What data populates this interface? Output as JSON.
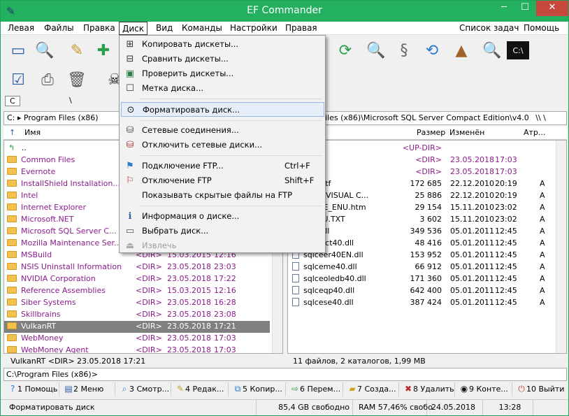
{
  "window": {
    "title": "EF Commander"
  },
  "menu": {
    "items": [
      "Левая",
      "Файлы",
      "Правка",
      "Диск",
      "Вид",
      "Команды",
      "Настройки",
      "Правая"
    ],
    "right": [
      "Список задач",
      "Помощь"
    ]
  },
  "drives": {
    "left": "C",
    "right": "\\"
  },
  "left": {
    "path": "C: ▸ Program Files (x86)",
    "col_name": "Имя",
    "updir": "..",
    "rows": [
      {
        "name": "Common Files",
        "d": "",
        "date": "",
        "time": ""
      },
      {
        "name": "Evernote",
        "d": "",
        "date": "",
        "time": ""
      },
      {
        "name": "InstallShield Installation...",
        "d": "",
        "date": "",
        "time": ""
      },
      {
        "name": "Intel",
        "d": "",
        "date": "",
        "time": ""
      },
      {
        "name": "Internet Explorer",
        "d": "",
        "date": "",
        "time": ""
      },
      {
        "name": "Microsoft.NET",
        "d": "",
        "date": "",
        "time": ""
      },
      {
        "name": "Microsoft SQL Server C...",
        "d": "",
        "date": "",
        "time": ""
      },
      {
        "name": "Mozilla Maintenance Ser...",
        "d": "",
        "date": "",
        "time": ""
      },
      {
        "name": "MSBuild",
        "d": "<DIR>",
        "date": "15.03.2015",
        "time": "12:16"
      },
      {
        "name": "NSIS Uninstall Information",
        "d": "<DIR>",
        "date": "23.05.2018",
        "time": "23:03"
      },
      {
        "name": "NVIDIA Corporation",
        "d": "<DIR>",
        "date": "23.05.2018",
        "time": "17:22"
      },
      {
        "name": "Reference Assemblies",
        "d": "<DIR>",
        "date": "15.03.2015",
        "time": "12:16"
      },
      {
        "name": "Siber Systems",
        "d": "<DIR>",
        "date": "23.05.2018",
        "time": "16:28"
      },
      {
        "name": "Skillbrains",
        "d": "<DIR>",
        "date": "23.05.2018",
        "time": "23:08"
      },
      {
        "name": "VulkanRT",
        "d": "<DIR>",
        "date": "23.05.2018",
        "time": "17:21"
      },
      {
        "name": "WebMoney",
        "d": "<DIR>",
        "date": "23.05.2018",
        "time": "17:03"
      },
      {
        "name": "WebMoney Agent",
        "d": "<DIR>",
        "date": "23.05.2018",
        "time": "17:03"
      }
    ],
    "status": "VulkanRT    <DIR>  23.05.2018   17:21"
  },
  "right": {
    "path": "rogram Files (x86)\\Microsoft SQL Server Compact Edition\\v4.0",
    "path_tail": "\\\\  \\",
    "col_size": "Размер",
    "col_date": "Изменён",
    "col_attr": "Атр...",
    "rows": [
      {
        "name": "",
        "size": "<UP-DIR>",
        "date": "",
        "time": "",
        "attr": ""
      },
      {
        "name": "p",
        "size": "<DIR>",
        "date": "23.05.2018",
        "time": "17:03",
        "attr": ""
      },
      {
        "name": "",
        "size": "<DIR>",
        "date": "23.05.2018",
        "time": "17:03",
        "attr": ""
      },
      {
        "name": "ENU.rtf",
        "size": "172 685",
        "date": "22.12.2010",
        "time": "20:19",
        "attr": "A"
      },
      {
        "name": "SOFT VISUAL C...",
        "size": "25 886",
        "date": "22.12.2010",
        "time": "20:19",
        "attr": "A"
      },
      {
        "name": "eSSCE_ENU.htm",
        "size": "29 154",
        "date": "15.11.2010",
        "time": "23:02",
        "attr": "A"
      },
      {
        "name": "T_ENU.TXT",
        "size": "3 602",
        "date": "15.11.2010",
        "time": "23:02",
        "attr": "A"
      },
      {
        "name": "e40.dll",
        "size": "349 536",
        "date": "05.01.2011",
        "time": "12:45",
        "attr": "A"
      },
      {
        "name": "ompact40.dll",
        "size": "48 416",
        "date": "05.01.2011",
        "time": "12:45",
        "attr": "A"
      },
      {
        "name": "sqlceer40EN.dll",
        "size": "153 952",
        "date": "05.01.2011",
        "time": "12:45",
        "attr": "A"
      },
      {
        "name": "sqlceme40.dll",
        "size": "66 912",
        "date": "05.01.2011",
        "time": "12:45",
        "attr": "A"
      },
      {
        "name": "sqlceoledb40.dll",
        "size": "171 360",
        "date": "05.01.2011",
        "time": "12:45",
        "attr": "A"
      },
      {
        "name": "sqlceqp40.dll",
        "size": "642 400",
        "date": "05.01.2011",
        "time": "12:45",
        "attr": "A"
      },
      {
        "name": "sqlcese40.dll",
        "size": "387 424",
        "date": "05.01.2011",
        "time": "12:45",
        "attr": "A"
      }
    ],
    "status": "11 файлов, 2 каталогов, 1,99 MB"
  },
  "cmdline": "C:\\Program Files (x86)>",
  "fkeys": [
    "1 Помощь",
    "2 Меню",
    "3 Смотр...",
    "4 Редак...",
    "5 Копир...",
    "6 Перем...",
    "7 Созда...",
    "8 Удалить",
    "9 Конте...",
    "10 Выйти"
  ],
  "statusbar": {
    "hint": "Форматировать диск",
    "free": "85,4 GB свободно",
    "ram": "RAM 57,46% свобо",
    "date": "24.05.2018",
    "time": "13:28"
  },
  "dropdown": {
    "items": [
      {
        "label": "Копировать дискеты...",
        "shortcut": ""
      },
      {
        "label": "Сравнить дискеты...",
        "shortcut": ""
      },
      {
        "label": "Проверить дискеты...",
        "shortcut": ""
      },
      {
        "label": "Метка диска...",
        "shortcut": ""
      },
      {
        "label": "Форматировать диск...",
        "shortcut": ""
      },
      {
        "label": "Сетевые соединения...",
        "shortcut": ""
      },
      {
        "label": "Отключить сетевые диски...",
        "shortcut": ""
      },
      {
        "label": "Подключение FTP...",
        "shortcut": "Ctrl+F"
      },
      {
        "label": "Отключение FTP",
        "shortcut": "Shift+F"
      },
      {
        "label": "Показывать скрытые файлы на FTP",
        "shortcut": ""
      },
      {
        "label": "Информация о диске...",
        "shortcut": ""
      },
      {
        "label": "Выбрать диск...",
        "shortcut": ""
      },
      {
        "label": "Извлечь",
        "shortcut": ""
      }
    ]
  }
}
